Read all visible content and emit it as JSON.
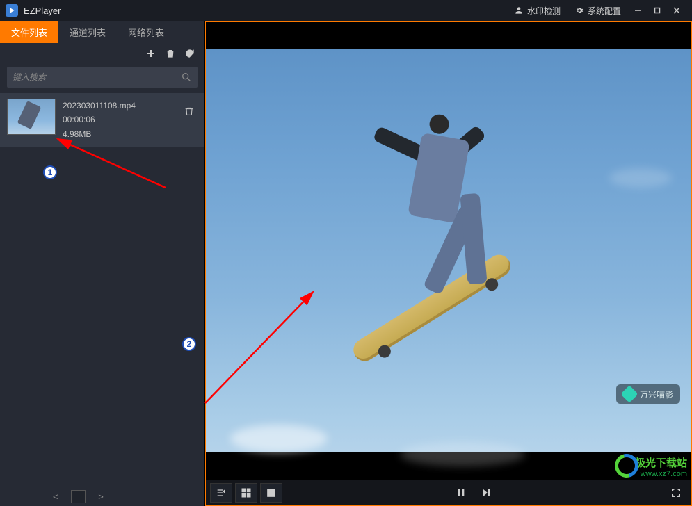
{
  "app": {
    "title": "EZPlayer"
  },
  "titlebar": {
    "watermark_btn": "水印检测",
    "config_btn": "系统配置"
  },
  "tabs": {
    "file_list": "文件列表",
    "channel_list": "通道列表",
    "network_list": "网络列表"
  },
  "search": {
    "placeholder": "键入搜索"
  },
  "files": [
    {
      "name": "202303011108.mp4",
      "duration": "00:00:06",
      "size": "4.98MB"
    }
  ],
  "annotations": {
    "m1": "1",
    "m2": "2"
  },
  "video_watermark": {
    "label": "万兴喵影"
  },
  "site_watermark": {
    "line1": "极光下载站",
    "line2": "www.xz7.com"
  }
}
